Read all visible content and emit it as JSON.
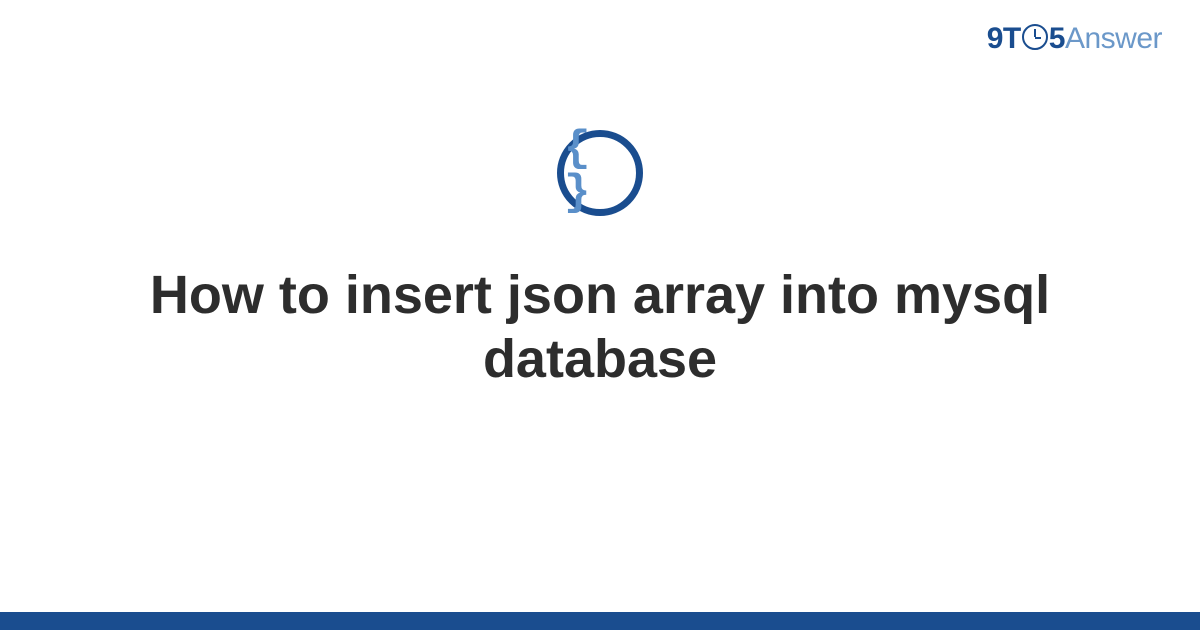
{
  "logo": {
    "part_9t": "9T",
    "part_5": "5",
    "part_answer": "Answer"
  },
  "topic_icon": {
    "name": "code-braces-icon",
    "glyph": "{ }"
  },
  "title": "How to insert json array into mysql database",
  "colors": {
    "brand_dark": "#1a4d8f",
    "brand_light": "#6b98c9",
    "icon_glyph": "#5a8fc9",
    "text": "#2d2d2d"
  }
}
